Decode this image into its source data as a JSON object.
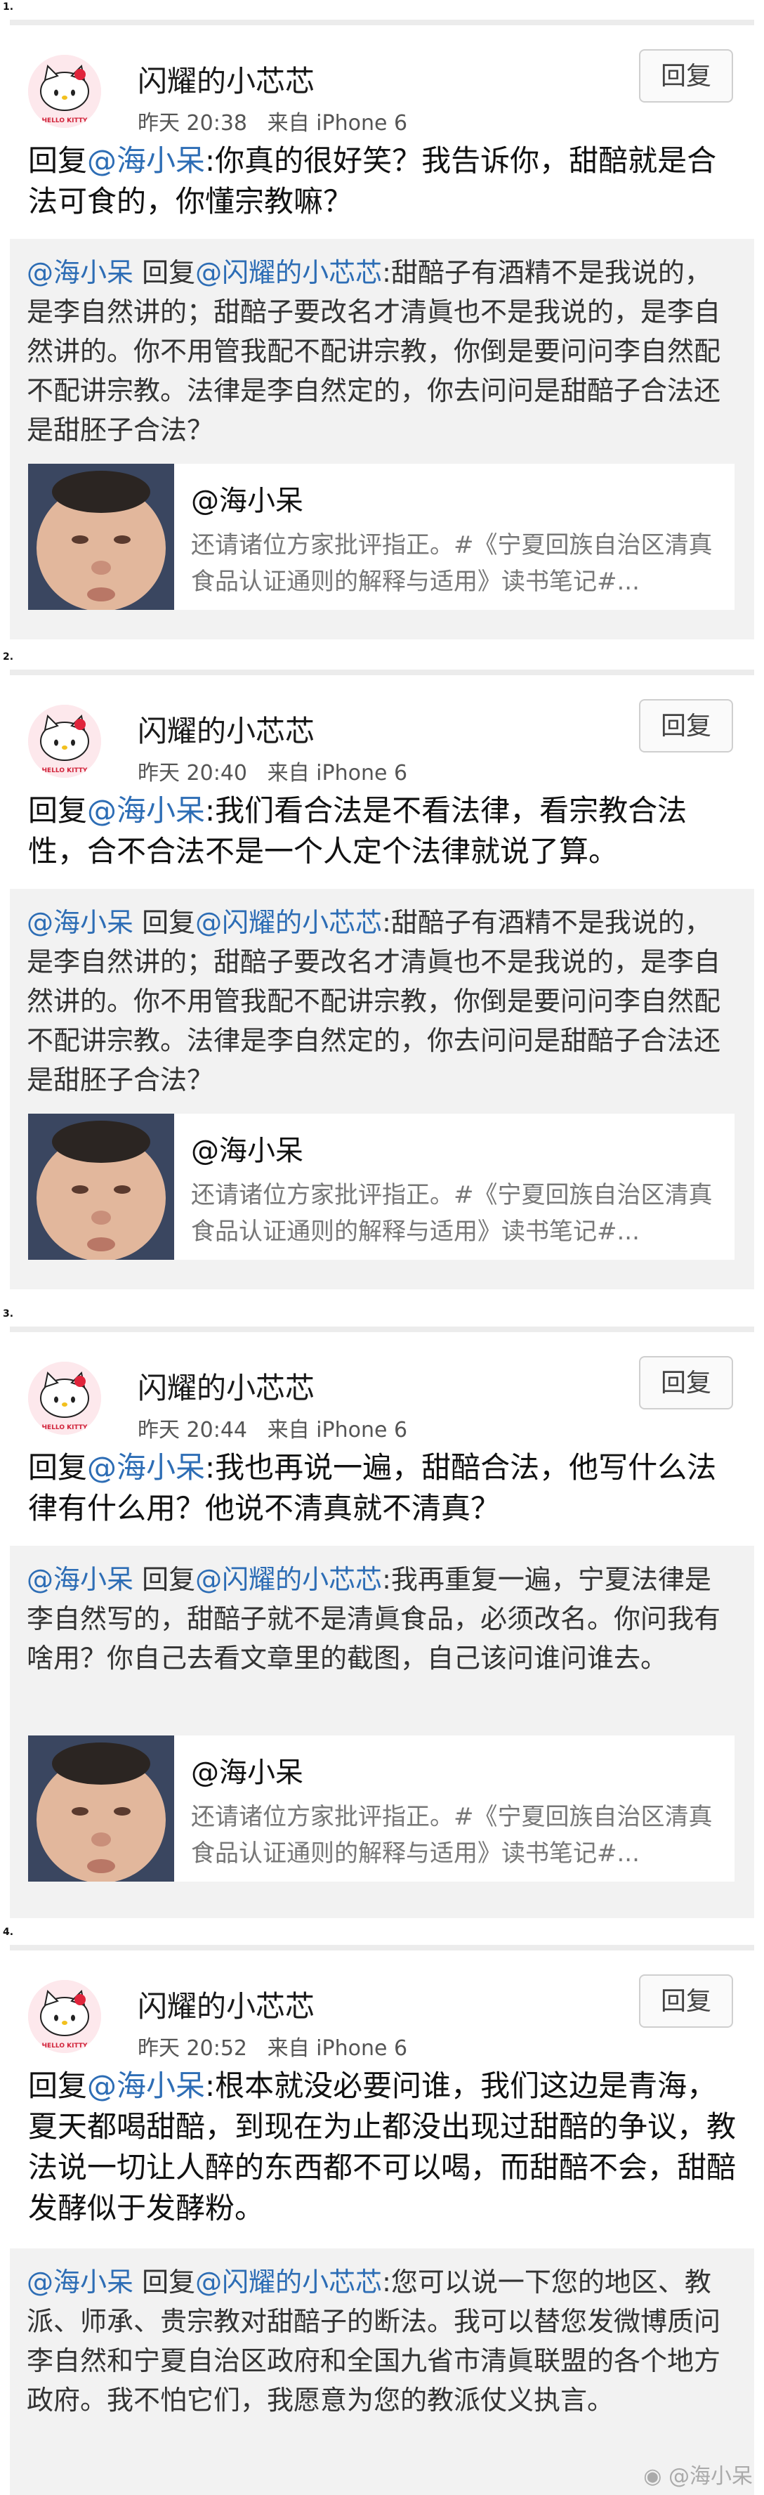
{
  "posts": [
    {
      "number": "1.",
      "author": "闪耀的小芯芯",
      "time": "昨天 20:38",
      "source": "来自 iPhone 6",
      "reply_button": "回复",
      "reply_prefix": "回复",
      "reply_mention": "@海小呆",
      "reply_text": ":你真的很好笑？我告诉你，甜醅就是合法可食的，你懂宗教嘛？",
      "quote_user": "@海小呆",
      "quote_reply_prefix": " 回复",
      "quote_mention": "@闪耀的小芯芯",
      "quote_text": ":甜醅子有酒精不是我说的，是李自然讲的；甜醅子要改名才清眞也不是我说的，是李自然讲的。你不用管我配不配讲宗教，你倒是要问问李自然配不配讲宗教。法律是李自然定的，你去问问是甜醅子合法还是甜胚子合法？",
      "card_title": "@海小呆",
      "card_desc": "还请诸位方家批评指正。#《宁夏回族自治区清真食品认证通则的解释与适用》读书笔记#..."
    },
    {
      "number": "2.",
      "author": "闪耀的小芯芯",
      "time": "昨天 20:40",
      "source": "来自 iPhone 6",
      "reply_button": "回复",
      "reply_prefix": "回复",
      "reply_mention": "@海小呆",
      "reply_text": ":我们看合法是不看法律，看宗教合法性，合不合法不是一个人定个法律就说了算。",
      "quote_user": "@海小呆",
      "quote_reply_prefix": " 回复",
      "quote_mention": "@闪耀的小芯芯",
      "quote_text": ":甜醅子有酒精不是我说的，是李自然讲的；甜醅子要改名才清眞也不是我说的，是李自然讲的。你不用管我配不配讲宗教，你倒是要问问李自然配不配讲宗教。法律是李自然定的，你去问问是甜醅子合法还是甜胚子合法？",
      "card_title": "@海小呆",
      "card_desc": "还请诸位方家批评指正。#《宁夏回族自治区清真食品认证通则的解释与适用》读书笔记#..."
    },
    {
      "number": "3.",
      "author": "闪耀的小芯芯",
      "time": "昨天 20:44",
      "source": "来自 iPhone 6",
      "reply_button": "回复",
      "reply_prefix": "回复",
      "reply_mention": "@海小呆",
      "reply_text": ":我也再说一遍，甜醅合法，他写什么法律有什么用？他说不清真就不清真？",
      "quote_user": "@海小呆",
      "quote_reply_prefix": " 回复",
      "quote_mention": "@闪耀的小芯芯",
      "quote_text": ":我再重复一遍，宁夏法律是李自然写的，甜醅子就不是清眞食品，必须改名。你问我有啥用？你自己去看文章里的截图，自己该问谁问谁去。",
      "card_title": "@海小呆",
      "card_desc": "还请诸位方家批评指正。#《宁夏回族自治区清真食品认证通则的解释与适用》读书笔记#..."
    },
    {
      "number": "4.",
      "author": "闪耀的小芯芯",
      "time": "昨天 20:52",
      "source": "来自 iPhone 6",
      "reply_button": "回复",
      "reply_prefix": "回复",
      "reply_mention": "@海小呆",
      "reply_text": ":根本就没必要问谁，我们这边是青海，夏天都喝甜醅，到现在为止都没出现过甜醅的争议，教法说一切让人醉的东西都不可以喝，而甜醅不会，甜醅发酵似于发酵粉。",
      "quote_user": "@海小呆",
      "quote_reply_prefix": " 回复",
      "quote_mention": "@闪耀的小芯芯",
      "quote_text": ":您可以说一下您的地区、教派、师承、贵宗教对甜醅子的断法。我可以替您发微博质问李自然和宁夏自治区政府和全国九省市清眞联盟的各个地方政府。我不怕它们，我愿意为您的教派仗义执言。"
    }
  ],
  "watermark": "@海小呆",
  "colors": {
    "mention": "#2d6db5",
    "quote_bg": "#f2f2f2",
    "divider": "#ececec"
  }
}
